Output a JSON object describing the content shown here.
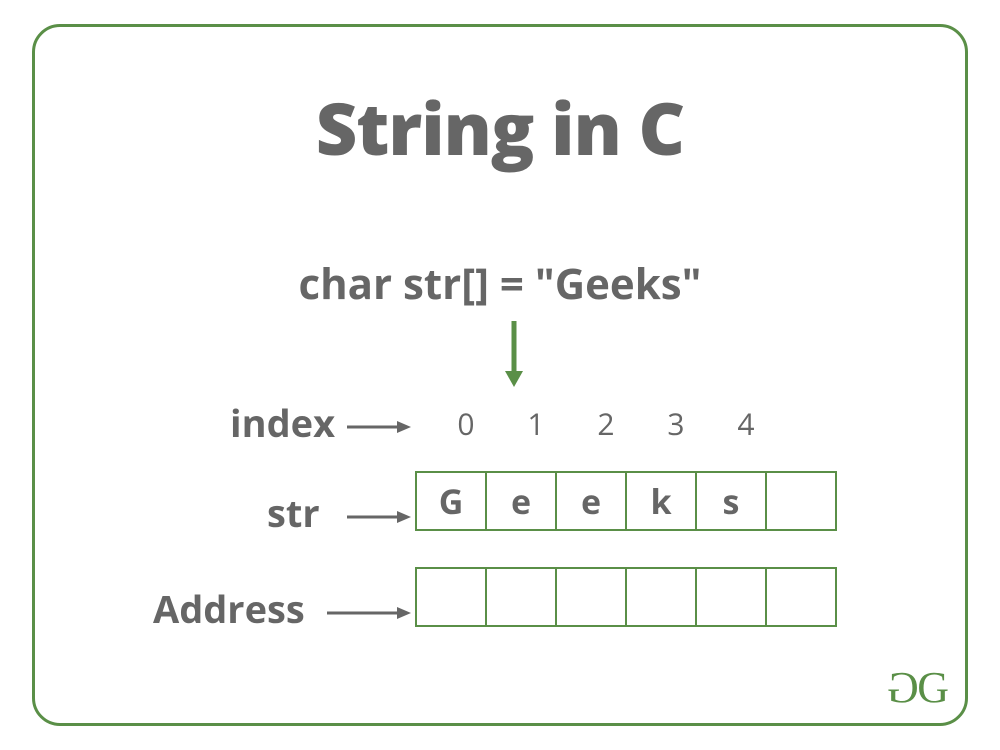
{
  "title": "String in C",
  "declaration": {
    "lhs": "char str[] = ",
    "rhs": "\"Geeks\""
  },
  "rows": {
    "index_label": "index",
    "str_label": "str",
    "address_label": "Address"
  },
  "indices": [
    "0",
    "1",
    "2",
    "3",
    "4"
  ],
  "str_cells": [
    "G",
    "e",
    "e",
    "k",
    "s",
    ""
  ],
  "address_cells": [
    "",
    "",
    "",
    "",
    "",
    ""
  ],
  "logo": {
    "left": "G",
    "right": "G"
  },
  "colors": {
    "border": "#5a8f47",
    "text": "#666666"
  }
}
